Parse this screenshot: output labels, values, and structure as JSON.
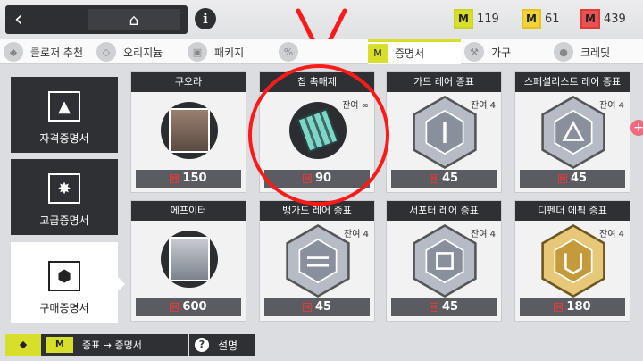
{
  "header": {
    "back_icon": "chevron-left-icon",
    "home_icon": "home-icon",
    "info_label": "i",
    "currencies": [
      {
        "icon": "green-certificate-icon",
        "value": "119",
        "color": "#c9d42a"
      },
      {
        "icon": "gold-certificate-icon",
        "value": "61",
        "color": "#e6c21a"
      },
      {
        "icon": "red-certificate-icon",
        "value": "439",
        "color": "#e03a3a"
      }
    ]
  },
  "tabs": [
    {
      "label": "클로저 추천",
      "icon": "closer-icon"
    },
    {
      "label": "오리지늄",
      "icon": "originium-icon"
    },
    {
      "label": "패키지",
      "icon": "package-icon"
    },
    {
      "label": "",
      "icon": "sale-icon"
    },
    {
      "label": "증명서",
      "icon": "certificate-icon",
      "active": true
    },
    {
      "label": "가구",
      "icon": "hammer-icon"
    },
    {
      "label": "크레딧",
      "icon": "credit-icon"
    }
  ],
  "sidebar": [
    {
      "label": "자격증명서",
      "icon": "qualification-icon"
    },
    {
      "label": "고급증명서",
      "icon": "advanced-icon"
    },
    {
      "label": "구매증명서",
      "icon": "purchase-cube-icon",
      "active": true
    }
  ],
  "items": [
    {
      "name": "쿠오라",
      "price": "150",
      "remain": "",
      "type": "portrait"
    },
    {
      "name": "칩 촉매제",
      "price": "90",
      "remain": "잔여 ∞",
      "type": "chip"
    },
    {
      "name": "가드 레어 증표",
      "price": "45",
      "remain": "잔여 4",
      "type": "hex-silver"
    },
    {
      "name": "스페셜리스트 레어 증표",
      "price": "45",
      "remain": "잔여 4",
      "type": "hex-silver"
    },
    {
      "name": "에프이터",
      "price": "600",
      "remain": "",
      "type": "portrait"
    },
    {
      "name": "뱅가드 레어 증표",
      "price": "45",
      "remain": "잔여 4",
      "type": "hex-silver"
    },
    {
      "name": "서포터 레어 증표",
      "price": "45",
      "remain": "잔여 4",
      "type": "hex-silver"
    },
    {
      "name": "디펜더 에픽 증표",
      "price": "180",
      "remain": "잔여 4",
      "type": "hex-gold"
    }
  ],
  "bottom": {
    "convert_label": "증표 → 증명서",
    "help_label": "설명",
    "help_icon": "question-icon"
  },
  "colors": {
    "accent": "#d8df2a",
    "dark": "#2f3034",
    "annotation": "#ff1a1a"
  }
}
